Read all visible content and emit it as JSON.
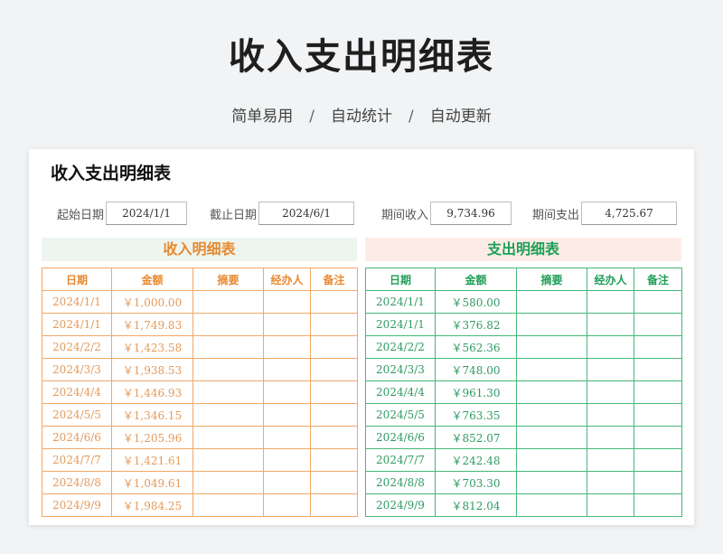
{
  "banner": {
    "title": "收入支出明细表",
    "tagline": [
      "简单易用",
      "自动统计",
      "自动更新"
    ],
    "separator": "/"
  },
  "sheet": {
    "title": "收入支出明细表",
    "filters": {
      "start_label": "起始日期",
      "start_value": "2024/1/1",
      "end_label": "截止日期",
      "end_value": "2024/6/1",
      "income_label": "期间收入",
      "income_value": "9,734.96",
      "expense_label": "期间支出",
      "expense_value": "4,725.67"
    },
    "income": {
      "title": "收入明细表",
      "color": "#e8892f",
      "headers": [
        "日期",
        "金额",
        "摘要",
        "经办人",
        "备注"
      ],
      "rows": [
        [
          "2024/1/1",
          "￥1,000.00",
          "",
          "",
          ""
        ],
        [
          "2024/1/1",
          "￥1,749.83",
          "",
          "",
          ""
        ],
        [
          "2024/2/2",
          "￥1,423.58",
          "",
          "",
          ""
        ],
        [
          "2024/3/3",
          "￥1,938.53",
          "",
          "",
          ""
        ],
        [
          "2024/4/4",
          "￥1,446.93",
          "",
          "",
          ""
        ],
        [
          "2024/5/5",
          "￥1,346.15",
          "",
          "",
          ""
        ],
        [
          "2024/6/6",
          "￥1,205.96",
          "",
          "",
          ""
        ],
        [
          "2024/7/7",
          "￥1,421.61",
          "",
          "",
          ""
        ],
        [
          "2024/8/8",
          "￥1,049.61",
          "",
          "",
          ""
        ],
        [
          "2024/9/9",
          "￥1,984.25",
          "",
          "",
          ""
        ]
      ]
    },
    "expense": {
      "title": "支出明细表",
      "color": "#1e9f57",
      "headers": [
        "日期",
        "金额",
        "摘要",
        "经办人",
        "备注"
      ],
      "rows": [
        [
          "2024/1/1",
          "￥580.00",
          "",
          "",
          ""
        ],
        [
          "2024/1/1",
          "￥376.82",
          "",
          "",
          ""
        ],
        [
          "2024/2/2",
          "￥562.36",
          "",
          "",
          ""
        ],
        [
          "2024/3/3",
          "￥748.00",
          "",
          "",
          ""
        ],
        [
          "2024/4/4",
          "￥961.30",
          "",
          "",
          ""
        ],
        [
          "2024/5/5",
          "￥763.35",
          "",
          "",
          ""
        ],
        [
          "2024/6/6",
          "￥852.07",
          "",
          "",
          ""
        ],
        [
          "2024/7/7",
          "￥242.48",
          "",
          "",
          ""
        ],
        [
          "2024/8/8",
          "￥703.30",
          "",
          "",
          ""
        ],
        [
          "2024/9/9",
          "￥812.04",
          "",
          "",
          ""
        ]
      ]
    }
  }
}
